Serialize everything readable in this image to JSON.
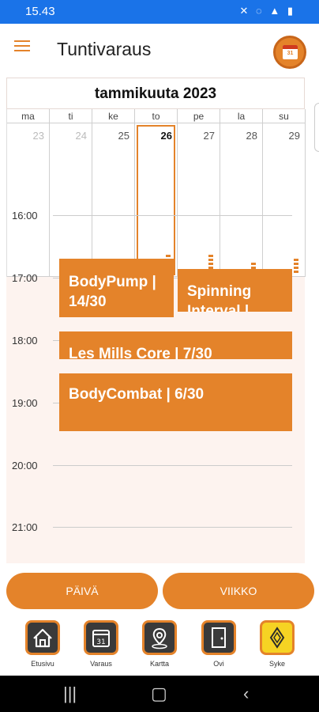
{
  "status_bar": {
    "time": "15.43",
    "icons": "✕ ◌ ▲ ▮"
  },
  "app_bar": {
    "title": "Tuntivaraus",
    "calendar_icon_number": "31"
  },
  "calendar": {
    "month": "tammikuuta 2023",
    "days": [
      {
        "name": "ma",
        "num": "23",
        "state": "past",
        "events": 0
      },
      {
        "name": "ti",
        "num": "24",
        "state": "past",
        "events": 0
      },
      {
        "name": "ke",
        "num": "25",
        "state": "normal",
        "events": 0
      },
      {
        "name": "to",
        "num": "26",
        "state": "today",
        "events": 5
      },
      {
        "name": "pe",
        "num": "27",
        "state": "normal",
        "events": 5
      },
      {
        "name": "la",
        "num": "28",
        "state": "normal",
        "events": 3
      },
      {
        "name": "su",
        "num": "29",
        "state": "normal",
        "events": 4
      }
    ]
  },
  "timeline": {
    "hours": [
      "16:00",
      "17:00",
      "18:00",
      "19:00",
      "20:00",
      "21:00"
    ],
    "events": [
      {
        "line1": "BodyPump |",
        "line2": "14/30"
      },
      {
        "line1": "Spinning",
        "line2": "Interval |"
      },
      {
        "line1": "Les Mills Core |  7/30",
        "line2": ""
      },
      {
        "line1": "BodyCombat |  6/30",
        "line2": ""
      }
    ]
  },
  "view_buttons": {
    "day": "PÄIVÄ",
    "week": "VIIKKO"
  },
  "bottom_nav": [
    {
      "label": "Etusivu",
      "icon": "home-icon"
    },
    {
      "label": "Varaus",
      "icon": "calendar-icon"
    },
    {
      "label": "Kartta",
      "icon": "map-pin-icon"
    },
    {
      "label": "Ovi",
      "icon": "door-icon"
    },
    {
      "label": "Syke",
      "icon": "syke-logo-icon"
    }
  ],
  "colors": {
    "accent": "#e4832a",
    "status_bar": "#1a73e8",
    "calendar_bg": "#fdf3ef"
  }
}
